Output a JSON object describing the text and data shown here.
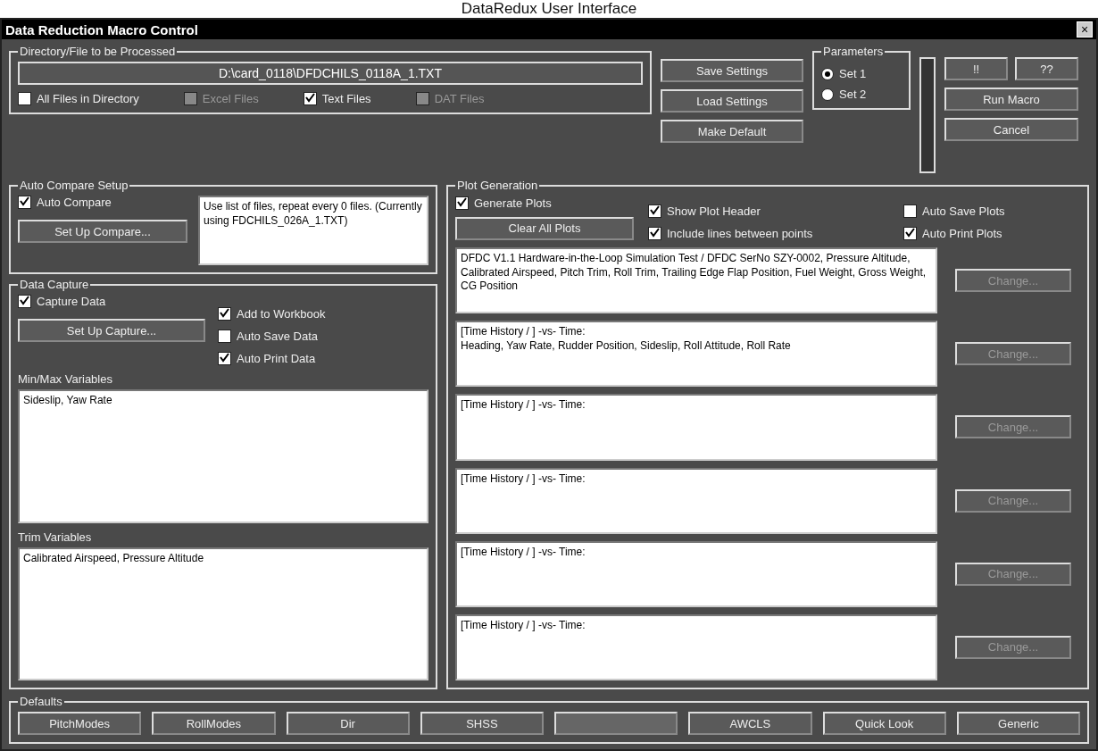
{
  "caption": "DataRedux User Interface",
  "window": {
    "title": "Data Reduction Macro Control",
    "close": "×"
  },
  "directory": {
    "label": "Directory/File to be Processed",
    "value": "D:\\card_0118\\DFDCHILS_0118A_1.TXT",
    "options": [
      {
        "label": "All Files in Directory",
        "checked": false,
        "disabled": false
      },
      {
        "label": "Excel Files",
        "checked": false,
        "disabled": true
      },
      {
        "label": "Text Files",
        "checked": true,
        "disabled": false
      },
      {
        "label": "DAT Files",
        "checked": false,
        "disabled": true
      }
    ]
  },
  "settings_buttons": [
    "Save Settings",
    "Load Settings",
    "Make Default"
  ],
  "parameters": {
    "label": "Parameters",
    "options": [
      {
        "label": "Set 1",
        "selected": true
      },
      {
        "label": "Set 2",
        "selected": false
      }
    ]
  },
  "top_buttons": [
    "!!",
    "??"
  ],
  "run_buttons": [
    "Run Macro",
    "Cancel"
  ],
  "auto_compare": {
    "label": "Auto Compare Setup",
    "checkbox": {
      "label": "Auto Compare",
      "checked": true
    },
    "button": "Set Up Compare...",
    "note": "Use list of files, repeat every 0 files. (Currently using FDCHILS_026A_1.TXT)"
  },
  "data_capture": {
    "label": "Data Capture",
    "checkbox": {
      "label": "Capture Data",
      "checked": true
    },
    "button": "Set Up Capture...",
    "options": [
      {
        "label": "Add to Workbook",
        "checked": true
      },
      {
        "label": "Auto Save Data",
        "checked": false
      },
      {
        "label": "Auto Print Data",
        "checked": true
      }
    ],
    "lists": [
      {
        "label": "Min/Max Variables",
        "value": "Sideslip, Yaw Rate"
      },
      {
        "label": "Trim Variables",
        "value": "Calibrated Airspeed, Pressure Altitude"
      }
    ]
  },
  "plot_generation": {
    "label": "Plot Generation",
    "checks_top": [
      {
        "label": "Generate Plots",
        "checked": true
      },
      {
        "label": "Show Plot Header",
        "checked": true
      },
      {
        "label": "Auto Save Plots",
        "checked": false
      }
    ],
    "button": "Clear All Plots",
    "checks_bottom": [
      {
        "label": "Include lines between points",
        "checked": true
      },
      {
        "label": "Auto Print Plots",
        "checked": true
      }
    ],
    "plots": [
      {
        "text": "DFDC V1.1 Hardware-in-the-Loop Simulation Test / DFDC SerNo SZY-0002, Pressure Altitude, Calibrated Airspeed, Pitch Trim, Roll Trim, Trailing Edge Flap Position, Fuel Weight, Gross Weight, CG Position",
        "button": "Change..."
      },
      {
        "text": "[Time History / ] -vs- Time:\nHeading, Yaw Rate, Rudder Position, Sideslip, Roll Attitude, Roll Rate",
        "button": "Change..."
      },
      {
        "text": "[Time History / ] -vs- Time:",
        "button": "Change..."
      },
      {
        "text": "[Time History / ] -vs- Time:",
        "button": "Change..."
      },
      {
        "text": "[Time History / ] -vs- Time:",
        "button": "Change..."
      },
      {
        "text": "[Time History / ] -vs- Time:",
        "button": "Change..."
      }
    ]
  },
  "defaults": {
    "label": "Defaults",
    "buttons": [
      {
        "kind": "labeled",
        "label": "PitchModes"
      },
      {
        "kind": "labeled",
        "label": "RollModes"
      },
      {
        "kind": "labeled",
        "label": "Dir"
      },
      {
        "kind": "labeled",
        "label": "SHSS"
      },
      {
        "kind": "blank"
      },
      {
        "kind": "labeled",
        "label": "AWCLS"
      },
      {
        "kind": "labeled",
        "label": "Quick Look"
      },
      {
        "kind": "labeled",
        "label": "Generic"
      }
    ]
  }
}
